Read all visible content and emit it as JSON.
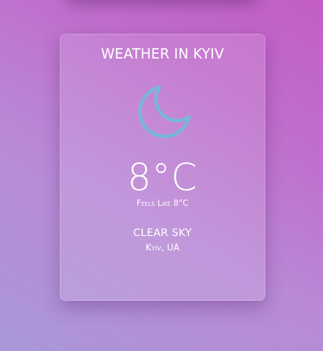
{
  "card": {
    "title": "WEATHER IN KYIV",
    "icon": "moon-icon",
    "icon_color": "#78b7d6",
    "temperature": "8°C",
    "feels_like_label": "Feels like",
    "feels_like_value": "8°C",
    "condition": "CLEAR SKY",
    "location": "Kyiv, UA"
  },
  "colors": {
    "background_start": "#a997d8",
    "background_end": "#c35dc6",
    "text": "#ffffff"
  }
}
